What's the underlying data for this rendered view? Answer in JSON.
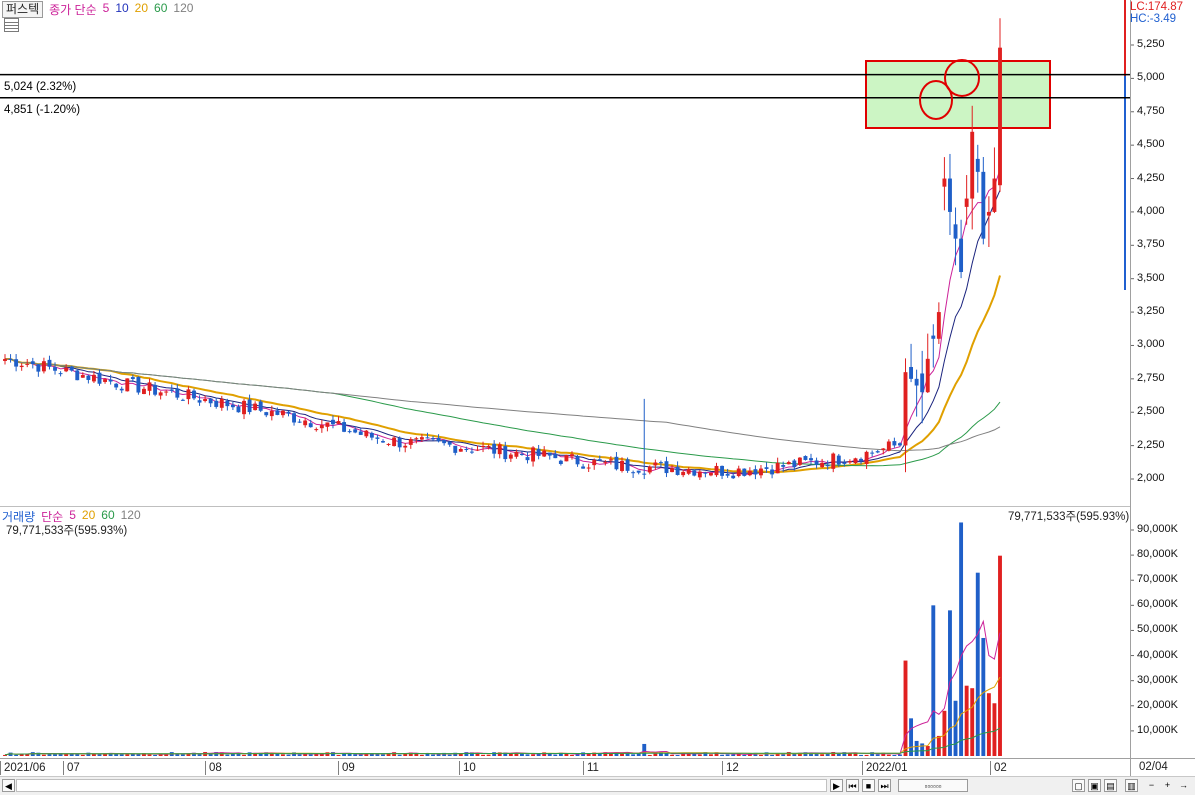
{
  "header": {
    "stock_name": "퍼스텍",
    "price_legend": [
      {
        "text": "종가 단순",
        "color": "#cc2299"
      },
      {
        "text": "5",
        "color": "#cc2299"
      },
      {
        "text": "10",
        "color": "#2233bb"
      },
      {
        "text": "20",
        "color": "#e0a000"
      },
      {
        "text": "60",
        "color": "#2a9a4a"
      },
      {
        "text": "120",
        "color": "#808080"
      }
    ],
    "volume_legend": [
      {
        "text": "거래량",
        "color": "#2060d0"
      },
      {
        "text": "단순",
        "color": "#cc2299"
      },
      {
        "text": "5",
        "color": "#cc2299"
      },
      {
        "text": "20",
        "color": "#e0a000"
      },
      {
        "text": "60",
        "color": "#2a9a4a"
      },
      {
        "text": "120",
        "color": "#808080"
      }
    ]
  },
  "markers": {
    "lc": "LC:174.87",
    "hc": "HC:-3.49"
  },
  "levels": [
    {
      "value": 5024,
      "label": "5,024 (2.32%)"
    },
    {
      "value": 4851,
      "label": "4,851 (-1.20%)"
    }
  ],
  "volume_panel": {
    "last_value_right": "79,771,533주(595.93%)",
    "last_value_left": "79,771,533주(595.93%)"
  },
  "colors": {
    "up": "#e02020",
    "down": "#1f5fc8",
    "ma5": "#cc2299",
    "ma10": "#1a237e",
    "ma20": "#e0a000",
    "ma60": "#2a9a4a",
    "ma120": "#808080",
    "highlight_fill": "#ccf5c4",
    "highlight_stroke": "#e00000"
  },
  "chart_data": [
    {
      "type": "candlestick",
      "ylim": [
        1850,
        5500
      ],
      "y_ticks": [
        2000,
        2250,
        2500,
        2750,
        3000,
        3250,
        3500,
        3750,
        4000,
        4250,
        4500,
        4750,
        5000,
        5250
      ],
      "y_tick_labels": [
        "2,000",
        "2,250",
        "2,500",
        "2,750",
        "3,000",
        "3,250",
        "3,500",
        "3,750",
        "4,000",
        "4,250",
        "4,500",
        "4,750",
        "5,000",
        "5,250"
      ],
      "x_labels": [
        "2021/06",
        "07",
        "08",
        "09",
        "10",
        "11",
        "12",
        "2022/01",
        "02",
        "02/04"
      ],
      "series": {
        "close_early": [
          2900,
          2860,
          2810,
          2770,
          2720,
          2680,
          2640,
          2600,
          2560,
          2520,
          2480,
          2430,
          2380,
          2320,
          2280,
          2260,
          2250,
          2230,
          2200,
          2180,
          2150,
          2120,
          2100,
          2090,
          2080,
          2070,
          2060,
          2080,
          2100,
          2130,
          2160,
          2200,
          2260
        ],
        "close_rally": [
          2800,
          2750,
          2700,
          2650,
          2900,
          3050,
          3250,
          4250,
          4000,
          3800,
          3550,
          4100,
          4600,
          4300,
          3800,
          4000,
          4250,
          5230
        ]
      }
    },
    {
      "type": "bar",
      "title": "거래량",
      "ylim": [
        0,
        95000
      ],
      "y_ticks": [
        10000,
        20000,
        30000,
        40000,
        50000,
        60000,
        70000,
        80000,
        90000
      ],
      "y_tick_labels": [
        "10,000K",
        "20,000K",
        "30,000K",
        "40,000K",
        "50,000K",
        "60,000K",
        "70,000K",
        "80,000K",
        "90,000K"
      ],
      "values_thousands_rally": [
        38000,
        15000,
        6000,
        5000,
        4000,
        60000,
        8000,
        18000,
        58000,
        22000,
        93000,
        28000,
        27000,
        73000,
        47000,
        25000,
        21000,
        79771
      ]
    }
  ]
}
